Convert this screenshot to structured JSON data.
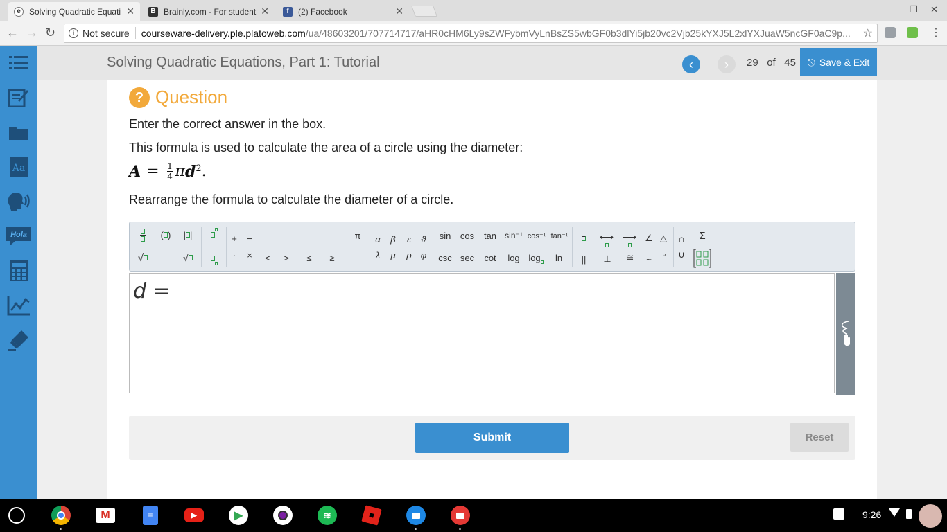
{
  "browser": {
    "tabs": [
      {
        "title": "Solving Quadratic Equati",
        "favicon": "plato-icon",
        "active": true
      },
      {
        "title": "Brainly.com - For student",
        "favicon": "brainly-icon",
        "active": false
      },
      {
        "title": "(2) Facebook",
        "favicon": "facebook-icon",
        "active": false
      }
    ],
    "security_label": "Not secure",
    "url_host": "courseware-delivery.ple.platoweb.com",
    "url_path": "/ua/48603201/707714717/aHR0cHM6Ly9sZWFybmVyLnBsZS5wbGF0b3dlYi5jb20vc2Vjb25kYXJ5L2xlYXJuaW5ncGF0aC9p..."
  },
  "header": {
    "lesson_title": "Solving Quadratic Equations, Part 1: Tutorial",
    "page_current": "29",
    "page_of": "of",
    "page_total": "45",
    "save_exit_label": "Save & Exit"
  },
  "sidebar": {
    "items": [
      "list-icon",
      "edit-notes-icon",
      "folder-icon",
      "dictionary-icon",
      "text-to-speech-icon",
      "translate-hola-icon",
      "calculator-icon",
      "graph-icon",
      "highlighter-icon"
    ],
    "hola": "Hola",
    "dict": "Aa"
  },
  "question": {
    "heading": "Question",
    "instruction": "Enter the correct answer in the box.",
    "prompt": "This formula is used to calculate the area of a circle using the diameter:",
    "formula": {
      "lhs": "A",
      "eq": "=",
      "num": "1",
      "den": "4",
      "pi": "π",
      "var": "d",
      "exp": "2",
      "end": "."
    },
    "task": "Rearrange the formula to calculate the diameter of a circle."
  },
  "math_toolbar": {
    "ops_top": [
      "+",
      "−"
    ],
    "ops_bot": [
      "·",
      "×"
    ],
    "eq": "=",
    "rel": [
      "<",
      ">",
      "≤",
      "≥"
    ],
    "pi": "π",
    "greek_top": [
      "α",
      "β",
      "ε",
      "ϑ"
    ],
    "greek_bot": [
      "λ",
      "μ",
      "ρ",
      "φ"
    ],
    "trig_top": [
      "sin",
      "cos",
      "tan",
      "sin⁻¹",
      "cos⁻¹",
      "tan⁻¹"
    ],
    "trig_bot": [
      "csc",
      "sec",
      "cot",
      "log",
      "log",
      "ln"
    ],
    "geo_top": [
      "⟷",
      "⟶",
      "∠",
      "△"
    ],
    "geo_bot": [
      "||",
      "⊥",
      "≅",
      "~",
      "°"
    ],
    "sets": [
      "∩",
      "∪"
    ],
    "sigma": "Σ"
  },
  "answer": {
    "var": "d",
    "eq": "=",
    "value": ""
  },
  "actions": {
    "submit_label": "Submit",
    "reset_label": "Reset"
  },
  "shelf": {
    "time": "9:26",
    "apps": [
      "chrome-icon",
      "gmail-icon",
      "docs-icon",
      "youtube-icon",
      "play-store-icon",
      "camera-icon",
      "spotify-icon",
      "roblox-icon",
      "files-icon",
      "photos-icon"
    ]
  },
  "colors": {
    "accent": "#3a8fd0",
    "question_orange": "#f2a93b",
    "shelf": "#000000"
  }
}
